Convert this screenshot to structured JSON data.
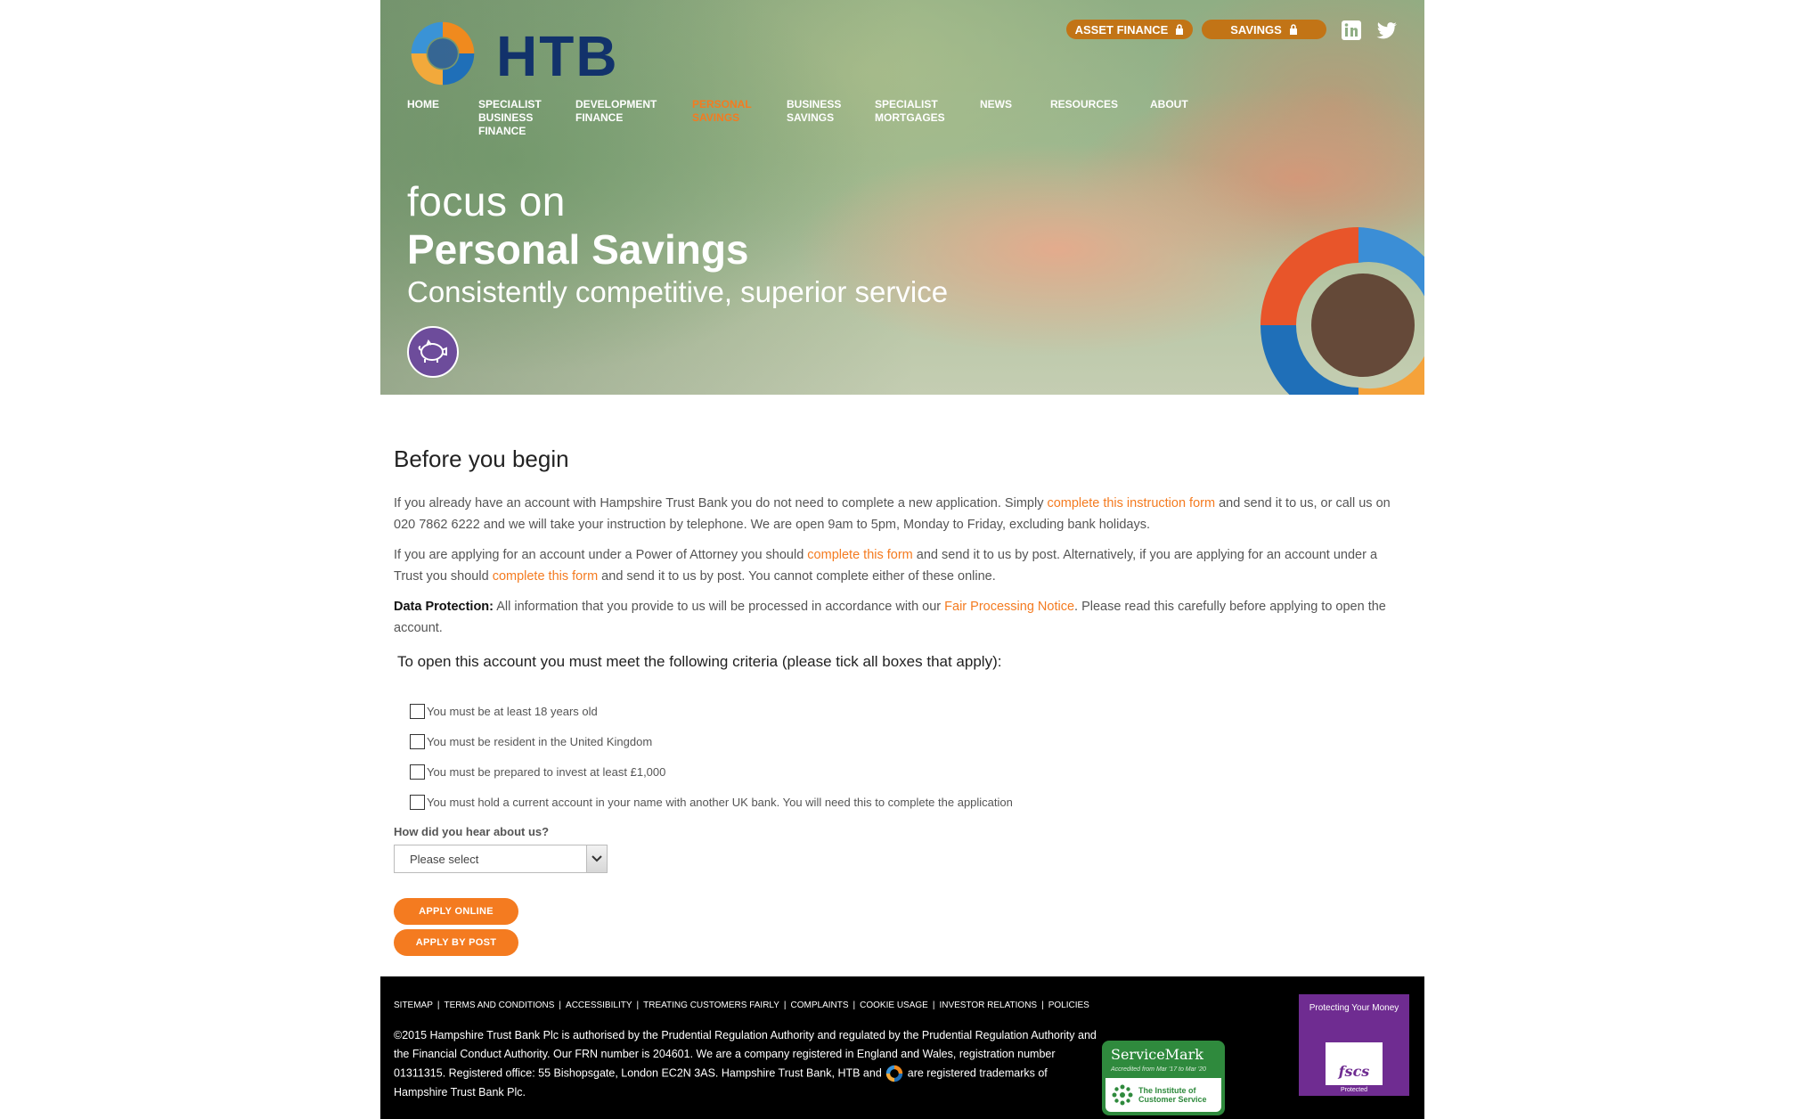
{
  "brand": {
    "name": "HTB",
    "accent": "#f47b20",
    "navy": "#12326b",
    "gold": "#c27416",
    "purple": "#6d4c9b"
  },
  "top_links": {
    "asset_finance": "ASSET FINANCE",
    "savings": "SAVINGS"
  },
  "social": [
    "linkedin-icon",
    "twitter-icon"
  ],
  "nav": {
    "items": [
      {
        "label": "HOME"
      },
      {
        "label": "SPECIALIST BUSINESS FINANCE"
      },
      {
        "label": "DEVELOPMENT FINANCE"
      },
      {
        "label": "PERSONAL SAVINGS",
        "active": true
      },
      {
        "label": "BUSINESS SAVINGS"
      },
      {
        "label": "SPECIALIST MORTGAGES"
      },
      {
        "label": "NEWS"
      },
      {
        "label": "RESOURCES"
      },
      {
        "label": "ABOUT"
      }
    ]
  },
  "hero": {
    "focus_on": "focus on",
    "title": "Personal Savings",
    "subtitle": "Consistently competitive, superior service",
    "icon": "piggy-bank-icon"
  },
  "content": {
    "title": "Before you begin",
    "p1": {
      "before": "If you already have an account with Hampshire Trust Bank you do not need to complete a new application. Simply ",
      "link": "complete this instruction form",
      "after": " and send it to us, or call us on 020 7862 6222 and we will take your instruction by telephone. We are open 9am to 5pm, Monday to Friday, excluding bank holidays."
    },
    "p2": {
      "before": "If you are applying for an account under a Power of Attorney you should ",
      "link1": "complete this form",
      "middle": " and send it to us by post. Alternatively, if you are applying for an account under a Trust you should ",
      "link2": "complete this form",
      "after": " and send it to us by post. You cannot complete either of these online."
    },
    "p3": {
      "bold": "Data Protection:",
      "before": " All information that you provide to us will be processed in accordance with our ",
      "link": "Fair Processing Notice",
      "after": ". Please read this carefully before applying to open the account."
    },
    "criteria_title": "To open this account you must meet the following criteria (please tick all boxes that apply):",
    "criteria": [
      {
        "label": "You must be at least 18 years old",
        "checked": false
      },
      {
        "label": "You must be resident in the United Kingdom",
        "checked": false
      },
      {
        "label": "You must be prepared to invest at least £1,000",
        "checked": false
      },
      {
        "label": "You must hold a current account in your name with another UK bank. You will need this to complete the application",
        "checked": false
      }
    ],
    "hear_label": "How did you hear about us?",
    "hear_value": "Please select",
    "apply_online": "APPLY ONLINE",
    "apply_post": "APPLY BY POST"
  },
  "footer": {
    "links": [
      "SITEMAP",
      "TERMS AND CONDITIONS",
      "ACCESSIBILITY",
      "TREATING CUSTOMERS FAIRLY",
      "COMPLAINTS",
      "COOKIE USAGE",
      "INVESTOR RELATIONS",
      "POLICIES"
    ],
    "text_before": "©2015 Hampshire Trust Bank Plc is authorised by the Prudential Regulation Authority and regulated by the Prudential Regulation Authority and the Financial Conduct Authority. Our FRN number is 204601. We are a company registered in England and Wales, registration number 01311315. Registered office: 55 Bishopsgate, London EC2N 3AS. Hampshire Trust Bank, HTB and ",
    "text_after": " are registered trademarks of Hampshire Trust Bank Plc.",
    "servicemark": {
      "title": "ServiceMark",
      "accredited": "Accredited from Mar '17 to Mar '20",
      "institute_line1": "The Institute of",
      "institute_line2": "Customer Service"
    },
    "fscs": {
      "title": "Protecting Your Money",
      "mark": "fscs",
      "protected": "Protected"
    }
  }
}
